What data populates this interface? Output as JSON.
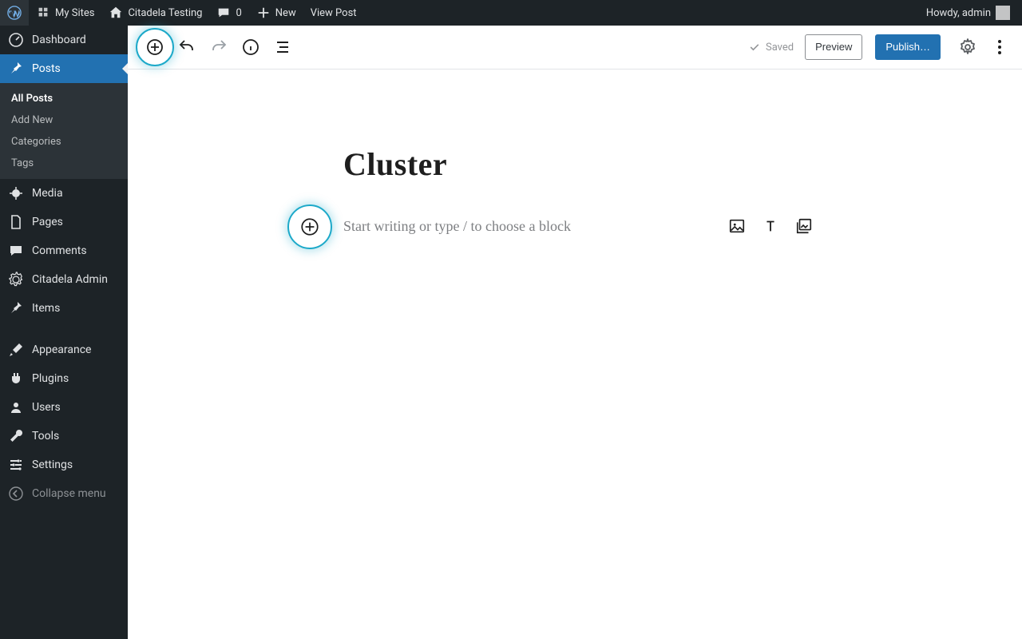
{
  "adminbar": {
    "my_sites": "My Sites",
    "site_name": "Citadela Testing",
    "comment_count": "0",
    "new_label": "New",
    "view_post": "View Post",
    "greeting": "Howdy, admin"
  },
  "sidebar": {
    "dashboard": "Dashboard",
    "items": [
      {
        "label": "Posts"
      },
      {
        "label": "Media"
      },
      {
        "label": "Pages"
      },
      {
        "label": "Comments"
      },
      {
        "label": "Citadela Admin"
      },
      {
        "label": "Items"
      }
    ],
    "items2": [
      {
        "label": "Appearance"
      },
      {
        "label": "Plugins"
      },
      {
        "label": "Users"
      },
      {
        "label": "Tools"
      },
      {
        "label": "Settings"
      }
    ],
    "collapse": "Collapse menu",
    "posts_submenu": [
      {
        "label": "All Posts"
      },
      {
        "label": "Add New"
      },
      {
        "label": "Categories"
      },
      {
        "label": "Tags"
      }
    ]
  },
  "toolbar": {
    "saved": "Saved",
    "preview": "Preview",
    "publish": "Publish…"
  },
  "document": {
    "title": "Cluster",
    "placeholder": "Start writing or type / to choose a block"
  }
}
